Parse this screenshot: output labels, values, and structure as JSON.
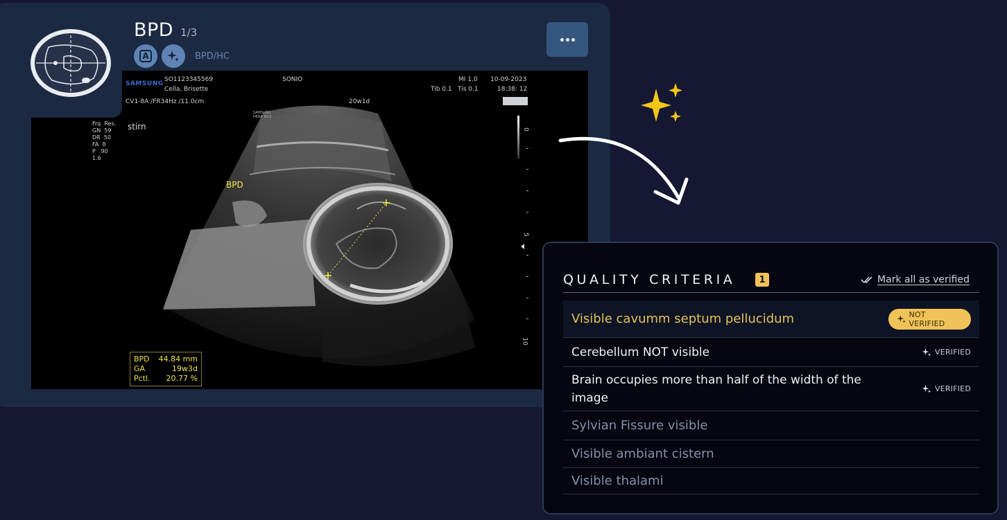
{
  "view": {
    "title": "BPD",
    "index": "1/3",
    "badge_letter": "A",
    "plane_label": "BPD/HC",
    "more_label": "More options"
  },
  "ultrasound": {
    "brand": "SAMSUNG",
    "patient_id": "SO1123345569",
    "patient_name": "Cella, Brisette",
    "institution": "SONIO",
    "probe": "CV1-8A /FR34Hz /11.0cm",
    "ga_header": "20w1d",
    "mi": "MI 1.0",
    "tib": "Tib 0.1",
    "tis": "Tis 0.1",
    "date": "10-09-2023",
    "time": "18:38: 12",
    "params": [
      "Frq  Res.",
      "GN  59",
      "DR  50",
      "FA  8",
      "P   90",
      "1.6"
    ],
    "mode_label": "stirn",
    "small_brand": "SAMSUNG\nHERA W10",
    "scale_labels": [
      "0",
      "5",
      "10"
    ],
    "bpd_label": "BPD",
    "measurements": [
      {
        "name": "BPD",
        "value": "44.84 mm"
      },
      {
        "name": "GA",
        "value": "19w3d"
      },
      {
        "name": "Pctl.",
        "value": "20.77 %"
      }
    ]
  },
  "quality": {
    "title": "QUALITY CRITERIA",
    "count": "1",
    "mark_all_label": "Mark all as verified",
    "criteria": [
      {
        "text": "Visible cavumm septum pellucidum",
        "status": "NOT VERIFIED"
      },
      {
        "text": "Cerebellum NOT visible",
        "status": "VERIFIED"
      },
      {
        "text": "Brain occupies more than half of the width of the image",
        "status": "VERIFIED"
      },
      {
        "text": "Sylvian Fissure visible",
        "status": ""
      },
      {
        "text": "Visible ambiant cistern",
        "status": ""
      },
      {
        "text": "Visible thalami",
        "status": ""
      }
    ]
  },
  "colors": {
    "background": "#151733",
    "card": "#1b2942",
    "accent": "#f0c35a",
    "sparkle": "#f5c518"
  }
}
